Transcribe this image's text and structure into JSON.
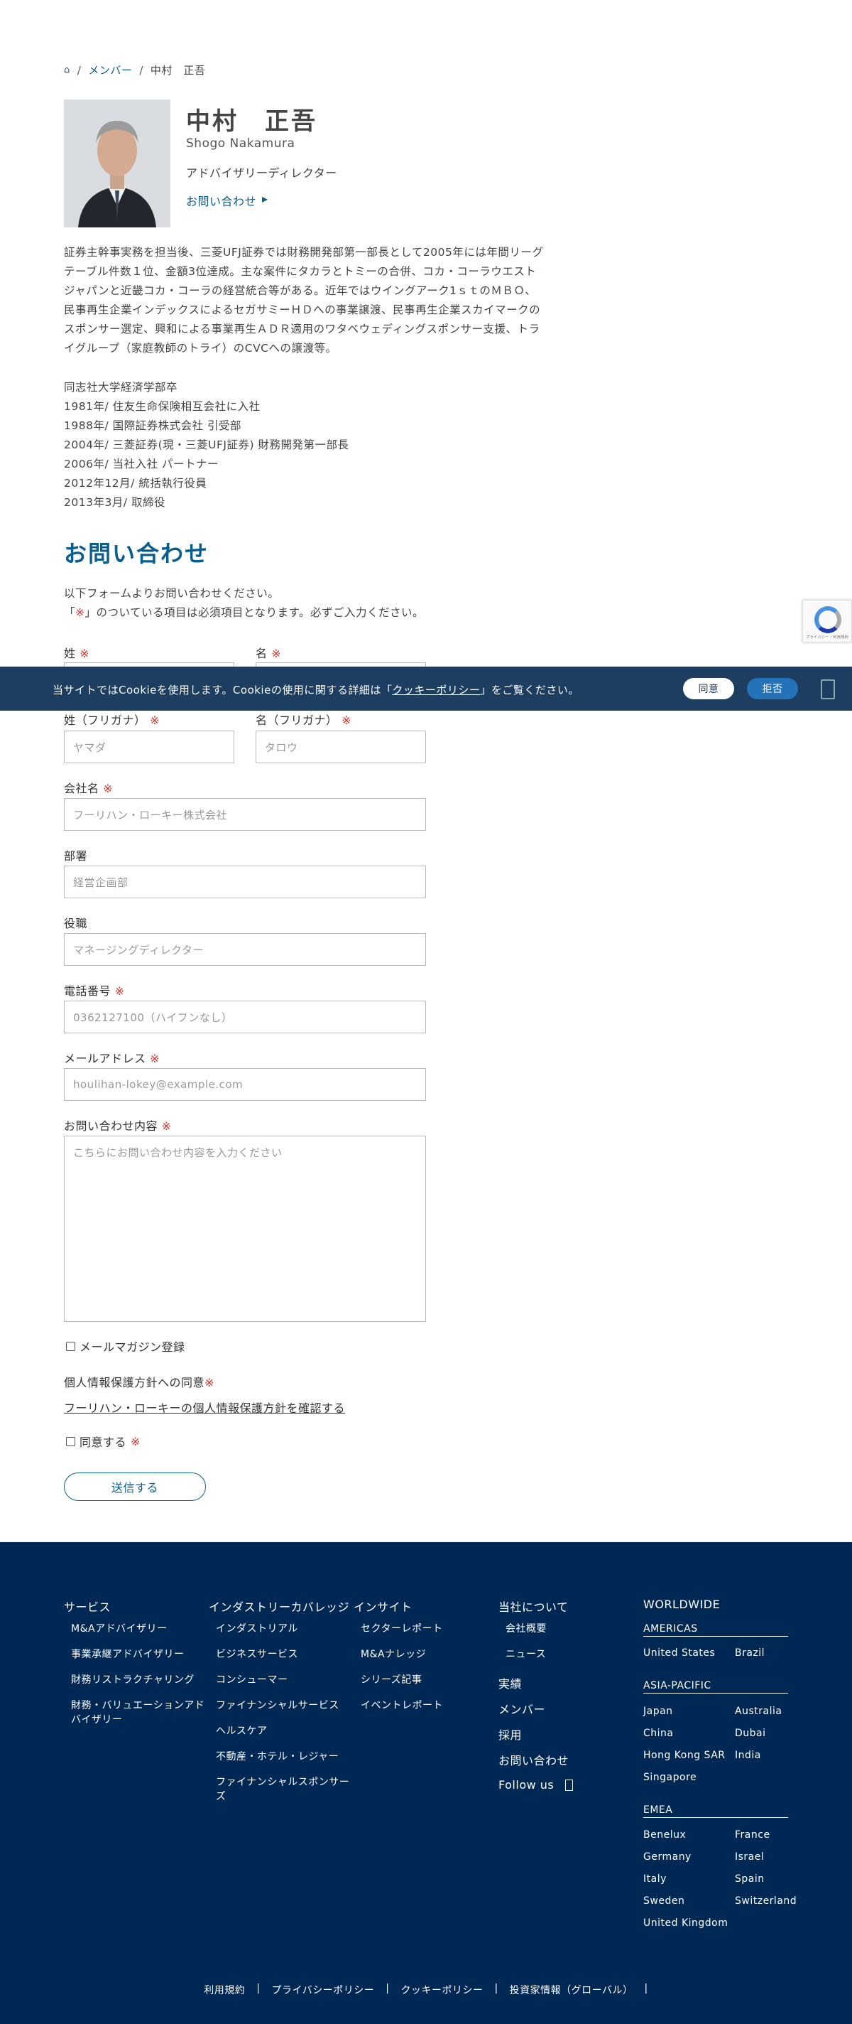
{
  "breadcrumb": {
    "home_icon": "home-icon",
    "members": "メンバー",
    "current": "中村　正吾",
    "sep": "/"
  },
  "profile": {
    "name": "中村　正吾",
    "name_en": "Shogo Nakamura",
    "role": "アドバイザリーディレクター",
    "contact_label": "お問い合わせ",
    "contact_icon": "arrow-circle-icon",
    "bio": [
      "証券主幹事実務を担当後、三菱UFJ証券では財務開発部第一部長として2005年には年間リーグ",
      "テーブル件数１位、金額3位達成。主な案件にタカラとトミーの合併、コカ・コーラウエスト",
      "ジャパンと近畿コカ・コーラの経営統合等がある。近年ではウイングアーク1ｓｔのＭＢＯ、",
      "民事再生企業インデックスによるセガサミーＨＤへの事業譲渡、民事再生企業スカイマークの",
      "スポンサー選定、興和による事業再生ＡＤＲ適用のワタベウェディングスポンサー支援、トラ",
      "イグループ（家庭教師のトライ）のCVCへの譲渡等。"
    ],
    "career": [
      "同志社大学経済学部卒",
      "1981年/ 住友生命保険相互会社に入社",
      "1988年/ 国際証券株式会社 引受部",
      "2004年/ 三菱証券(現・三菱UFJ証券) 財務開発第一部長",
      "2006年/ 当社入社 パートナー",
      "2012年12月/ 統括執行役員",
      "2013年3月/ 取締役"
    ]
  },
  "form": {
    "title": "お問い合わせ",
    "intro_1": "以下フォームよりお問い合わせください。",
    "intro_2_pre": "「",
    "intro_2_mark": "※",
    "intro_2_post": "」のついている項目は必須項目となります。必ずご入力ください。",
    "req_mark": "※",
    "last_name": {
      "label": "姓",
      "placeholder": ""
    },
    "first_name": {
      "label": "名",
      "placeholder": ""
    },
    "last_kana": {
      "label": "姓（フリガナ）",
      "placeholder": "ヤマダ"
    },
    "first_kana": {
      "label": "名（フリガナ）",
      "placeholder": "タロウ"
    },
    "company": {
      "label": "会社名",
      "placeholder": "フーリハン・ローキー株式会社"
    },
    "department": {
      "label": "部署",
      "placeholder": "経営企画部"
    },
    "position": {
      "label": "役職",
      "placeholder": "マネージングディレクター"
    },
    "phone": {
      "label": "電話番号",
      "placeholder": "0362127100（ハイフンなし）"
    },
    "email": {
      "label": "メールアドレス",
      "placeholder": "houlihan-lokey@example.com"
    },
    "message": {
      "label": "お問い合わせ内容",
      "placeholder": "こちらにお問い合わせ内容を入力ください"
    },
    "newsletter": "メールマガジン登録",
    "privacy_title": "個人情報保護方針への同意",
    "privacy_link": "フーリハン・ローキーの個人情報保護方針を確認する",
    "agree": "同意する",
    "submit": "送信する"
  },
  "cookie": {
    "text_pre": "当サイトではCookieを使用します。Cookieの使用に関する詳細は「",
    "link": "クッキーポリシー",
    "text_post": "」をご覧ください。",
    "agree": "同意",
    "decline": "拒否"
  },
  "recaptcha": {
    "text": "プライバシー・利用規約"
  },
  "footer": {
    "services": {
      "title": "サービス",
      "items": [
        "M&Aアドバイザリー",
        "事業承継アドバイザリー",
        "財務リストラクチャリング",
        "財務・バリュエーションアド",
        "バイザリー"
      ]
    },
    "industry": {
      "title": "インダストリーカバレッジ",
      "items": [
        "インダストリアル",
        "ビジネスサービス",
        "コンシューマー",
        "ファイナンシャルサービス",
        "ヘルスケア",
        "不動産・ホテル・レジャー",
        "ファイナンシャルスポンサー",
        "ズ"
      ]
    },
    "insight": {
      "title": "インサイト",
      "items": [
        "セクターレポート",
        "M&Aナレッジ",
        "シリーズ記事",
        "イベントレポート"
      ]
    },
    "about": {
      "title": "当社について",
      "items": [
        "会社概要",
        "ニュース"
      ]
    },
    "links": [
      "実績",
      "メンバー",
      "採用",
      "お問い合わせ"
    ],
    "follow": "Follow us",
    "follow_icon": "linkedin-icon",
    "worldwide": "WORLDWIDE",
    "americas": {
      "title": "AMERICAS",
      "items": [
        "United States",
        "Brazil"
      ]
    },
    "apac": {
      "title": "ASIA-PACIFIC",
      "items": [
        "Japan",
        "Australia",
        "China",
        "Dubai",
        "Hong Kong SAR",
        "India",
        "Singapore"
      ]
    },
    "emea": {
      "title": "EMEA",
      "items": [
        "Benelux",
        "France",
        "Germany",
        "Israel",
        "Italy",
        "Spain",
        "Sweden",
        "Switzerland",
        "United Kingdom"
      ]
    },
    "bottom": [
      "利用規約",
      "プライバシーポリシー",
      "クッキーポリシー",
      "投資家情報（グローバル）"
    ],
    "bottom_sep": "|"
  },
  "colors": {
    "accent": "#0a5e8f",
    "footer_bg": "#002855",
    "cookie_bg": "#1d3e61",
    "required": "#d9312b"
  }
}
